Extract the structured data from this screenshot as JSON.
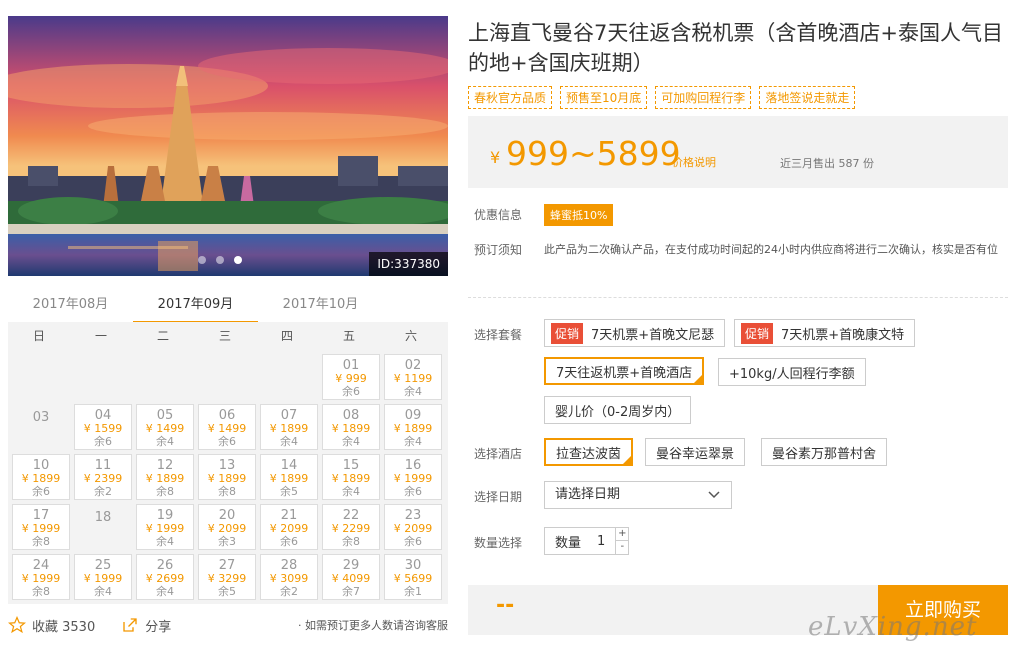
{
  "hero": {
    "id_text": "ID:337380",
    "dot_count": 3,
    "active_dot": 2
  },
  "calendar": {
    "months": [
      "2017年08月",
      "2017年09月",
      "2017年10月"
    ],
    "active_month": 1,
    "weekdays": [
      "日",
      "一",
      "二",
      "三",
      "四",
      "五",
      "六"
    ],
    "days": [
      {
        "d": "01",
        "p": "¥ 999",
        "s": "余6"
      },
      {
        "d": "02",
        "p": "¥ 1199",
        "s": "余4"
      },
      {
        "d": "03",
        "p": "",
        "s": ""
      },
      {
        "d": "04",
        "p": "¥ 1599",
        "s": "余6"
      },
      {
        "d": "05",
        "p": "¥ 1499",
        "s": "余4"
      },
      {
        "d": "06",
        "p": "¥ 1499",
        "s": "余6"
      },
      {
        "d": "07",
        "p": "¥ 1899",
        "s": "余4"
      },
      {
        "d": "08",
        "p": "¥ 1899",
        "s": "余4"
      },
      {
        "d": "09",
        "p": "¥ 1899",
        "s": "余4"
      },
      {
        "d": "10",
        "p": "¥ 1899",
        "s": "余6"
      },
      {
        "d": "11",
        "p": "¥ 2399",
        "s": "余2"
      },
      {
        "d": "12",
        "p": "¥ 1899",
        "s": "余8"
      },
      {
        "d": "13",
        "p": "¥ 1899",
        "s": "余8"
      },
      {
        "d": "14",
        "p": "¥ 1899",
        "s": "余5"
      },
      {
        "d": "15",
        "p": "¥ 1899",
        "s": "余4"
      },
      {
        "d": "16",
        "p": "¥ 1999",
        "s": "余6"
      },
      {
        "d": "17",
        "p": "¥ 1999",
        "s": "余8"
      },
      {
        "d": "18",
        "p": "",
        "s": ""
      },
      {
        "d": "19",
        "p": "¥ 1999",
        "s": "余4"
      },
      {
        "d": "20",
        "p": "¥ 2099",
        "s": "余3"
      },
      {
        "d": "21",
        "p": "¥ 2099",
        "s": "余6"
      },
      {
        "d": "22",
        "p": "¥ 2299",
        "s": "余8"
      },
      {
        "d": "23",
        "p": "¥ 2099",
        "s": "余6"
      },
      {
        "d": "24",
        "p": "¥ 1999",
        "s": "余8"
      },
      {
        "d": "25",
        "p": "¥ 1999",
        "s": "余4"
      },
      {
        "d": "26",
        "p": "¥ 2699",
        "s": "余4"
      },
      {
        "d": "27",
        "p": "¥ 3299",
        "s": "余5"
      },
      {
        "d": "28",
        "p": "¥ 3099",
        "s": "余2"
      },
      {
        "d": "29",
        "p": "¥ 4099",
        "s": "余7"
      },
      {
        "d": "30",
        "p": "¥ 5699",
        "s": "余1"
      }
    ],
    "first_weekday": 5
  },
  "actions": {
    "favorite_label": "收藏 3530",
    "share_label": "分享",
    "note": "· 如需预订更多人数请咨询客服"
  },
  "product": {
    "title": "上海直飞曼谷7天往返含税机票（含首晚酒店+泰国人气目的地+含国庆班期）",
    "tags": [
      "春秋官方品质",
      "预售至10月底",
      "可加购回程行李",
      "落地签说走就走"
    ],
    "currency": "¥",
    "price": "999~5899",
    "price_note": "价格说明",
    "sold": "近三月售出 587 份"
  },
  "info": {
    "discount_label": "优惠信息",
    "discount_badge": "蜂蜜抵10%",
    "notice_label": "预订须知",
    "notice_text": "此产品为二次确认产品，在支付成功时间起的24小时内供应商将进行二次确认，核实是否有位"
  },
  "packages": {
    "label": "选择套餐",
    "promo": "促销",
    "items": [
      {
        "text": "7天机票+首晚文尼瑟",
        "promo": true
      },
      {
        "text": "7天机票+首晚康文特",
        "promo": true
      },
      {
        "text": "7天往返机票+首晚酒店",
        "selected": true
      },
      {
        "text": "+10kg/人回程行李额"
      },
      {
        "text": "婴儿价（0-2周岁内）"
      }
    ]
  },
  "hotels": {
    "label": "选择酒店",
    "items": [
      {
        "text": "拉查达波茵",
        "selected": true
      },
      {
        "text": "曼谷幸运翠景"
      },
      {
        "text": "曼谷素万那普村舍"
      }
    ]
  },
  "date": {
    "label": "选择日期",
    "placeholder": "请选择日期"
  },
  "quantity": {
    "label": "数量选择",
    "inner_label": "数量",
    "value": "1",
    "plus": "+",
    "minus": "-"
  },
  "buy": {
    "total": "--",
    "button": "立即购买",
    "watermark": "eLvXing.net"
  },
  "colors": {
    "accent": "#f39800",
    "promo": "#e94f37"
  }
}
